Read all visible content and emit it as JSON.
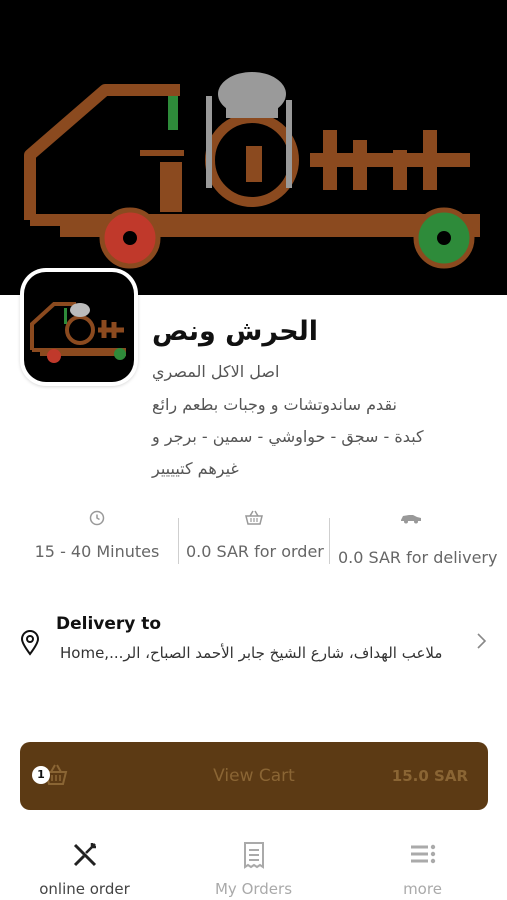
{
  "restaurant": {
    "name": "الحرش ونص",
    "description_lines": [
      "اصل الاكل المصري",
      "نقدم ساندوتشات و وجبات بطعم رائع",
      "كبدة - سجق - حواوشي - سمين - برجر و",
      "غيرهم كتيييير"
    ]
  },
  "stats": {
    "time": "15 - 40 Minutes",
    "min_order": "0.0 SAR for order",
    "delivery_fee": "0.0 SAR for delivery"
  },
  "icons": {
    "time": "clock-icon",
    "order": "basket-icon",
    "delivery": "car-icon",
    "location": "location-pin-icon",
    "chevron": "chevron-right-icon",
    "cart": "cart-icon",
    "tab_online": "fork-knife-icon",
    "tab_orders": "receipt-icon",
    "tab_more": "menu-icon"
  },
  "delivery": {
    "title": "Delivery to",
    "address": "Home,...ملاعب الهداف، شارع الشيخ جابر الأحمد الصباح، الر"
  },
  "cart": {
    "count": "1",
    "label": "View Cart",
    "total": "15.0 SAR"
  },
  "tabs": [
    {
      "label": "online order",
      "active": true
    },
    {
      "label": "My Orders",
      "active": false
    },
    {
      "label": "more",
      "active": false
    }
  ],
  "colors": {
    "brand_brown": "#5c3a14",
    "logo_brown": "#8b4a1f",
    "wheel_red": "#c0392b",
    "wheel_green": "#2e8b3a"
  }
}
